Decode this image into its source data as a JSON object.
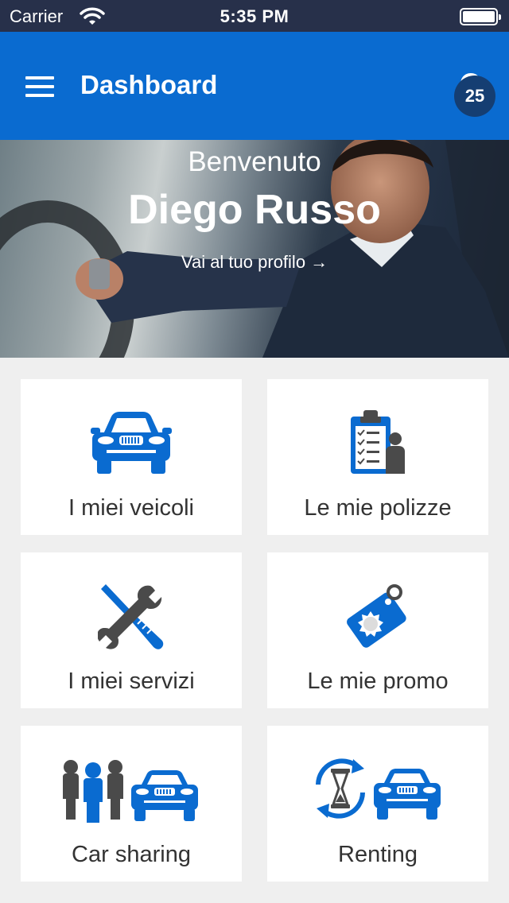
{
  "status_bar": {
    "carrier": "Carrier",
    "time": "5:35 PM"
  },
  "app_bar": {
    "title": "Dashboard",
    "notification_count": "25"
  },
  "hero": {
    "greeting": "Benvenuto",
    "user_name": "Diego Russo",
    "profile_link": "Vai al tuo profilo",
    "profile_link_arrow": "→"
  },
  "tiles": [
    {
      "label": "I miei veicoli",
      "icon": "car-icon"
    },
    {
      "label": "Le mie polizze",
      "icon": "clipboard-person-icon"
    },
    {
      "label": "I miei servizi",
      "icon": "wrench-screwdriver-icon"
    },
    {
      "label": "Le mie promo",
      "icon": "promo-tag-icon"
    },
    {
      "label": "Car sharing",
      "icon": "people-car-icon"
    },
    {
      "label": "Renting",
      "icon": "hourglass-car-icon"
    }
  ],
  "colors": {
    "primary": "#0a6bd0",
    "status_bar": "#27304a",
    "badge": "#153e72",
    "background": "#efefef",
    "icon_gray": "#4a4a4a"
  }
}
